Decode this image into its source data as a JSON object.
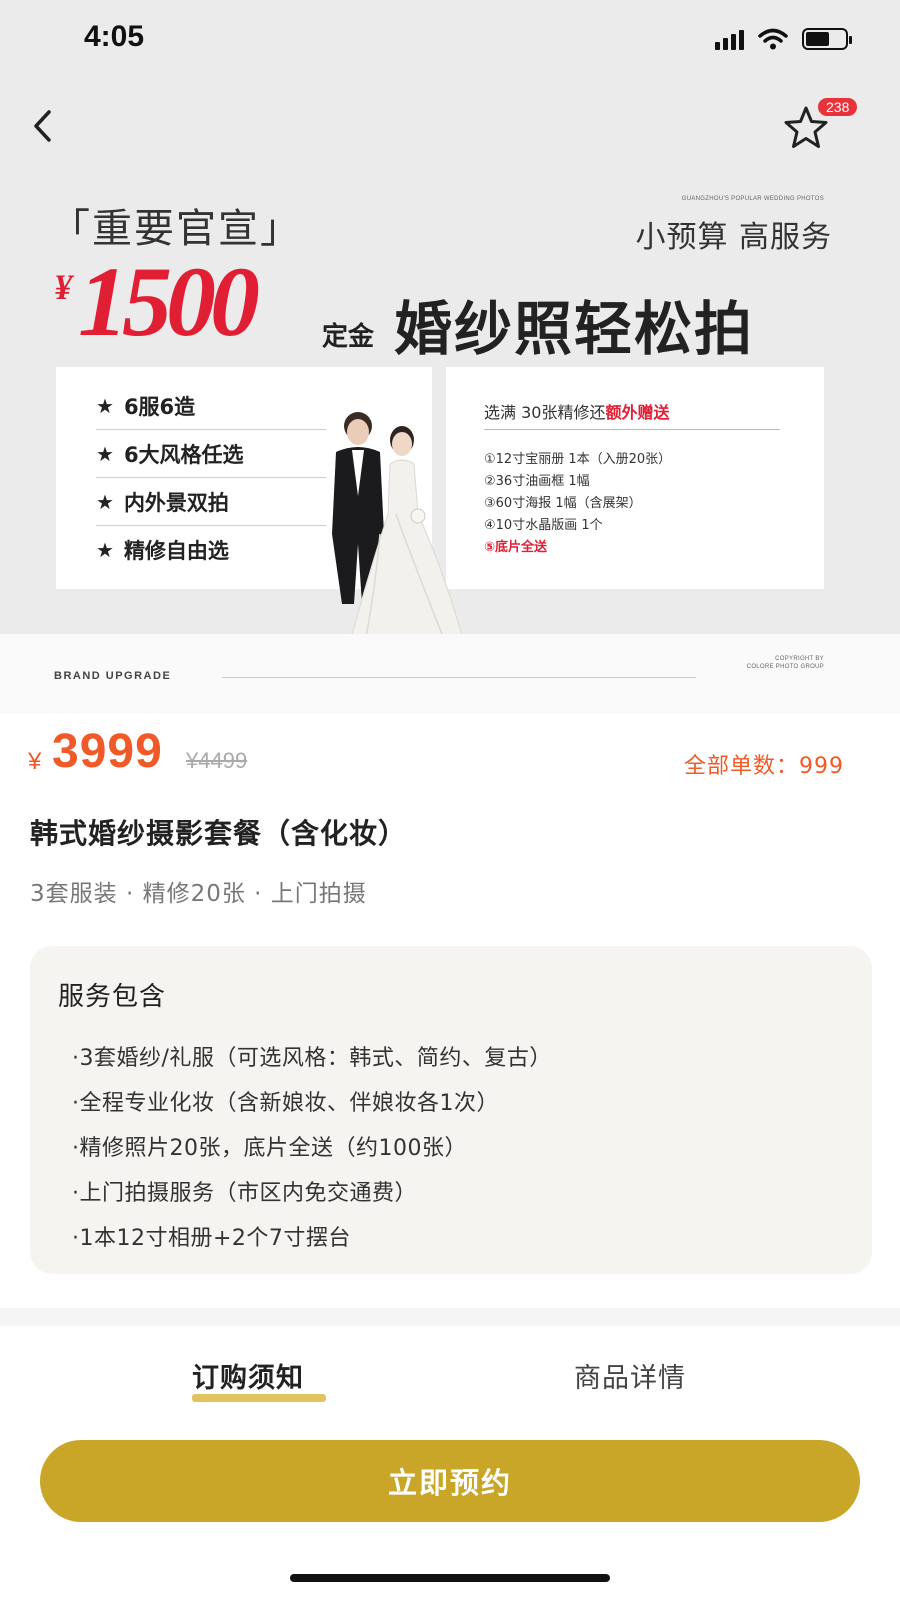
{
  "status_bar": {
    "time": "4:05"
  },
  "header": {
    "favorite_count": "238"
  },
  "banner": {
    "announce_title": "「重要官宣」",
    "tiny_caption_top": "GUANGZHOU'S POPULAR WEDDING PHOTOS",
    "subtitle": "小预算 高服务",
    "promo_currency": "¥",
    "promo_price": "1500",
    "deposit_label": "定金",
    "tagline": "婚纱照轻松拍",
    "features": [
      "6服6造",
      "6大风格任选",
      "内外景双拍",
      "精修自由选"
    ],
    "bonus_heading": "选满 30张精修还",
    "bonus_heading_highlight": "额外赠送",
    "bonus_items": [
      "①12寸宝丽册 1本（入册20张）",
      "②36寸油画框 1幅",
      "③60寸海报 1幅（含展架）",
      "④10寸水晶版画 1个",
      "⑤底片全送"
    ]
  },
  "brand": {
    "label": "BRAND   UPGRADE",
    "copyright_line1": "COPYRIGHT BY",
    "copyright_line2": "COLORE PHOTO GROUP"
  },
  "product": {
    "currency": "¥",
    "price": "3999",
    "original_price": "¥4499",
    "sold_label": "全部单数：",
    "sold_count": "999",
    "title": "韩式婚纱摄影套餐（含化妆）",
    "tags": "3套服装 · 精修20张 · 上门拍摄"
  },
  "service": {
    "title": "服务包含",
    "items": [
      "·3套婚纱/礼服（可选风格：韩式、简约、复古）",
      "·全程专业化妆（含新娘妆、伴娘妆各1次）",
      "·精修照片20张，底片全送（约100张）",
      "·上门拍摄服务（市区内免交通费）",
      "·1本12寸相册+2个7寸摆台"
    ]
  },
  "tabs": {
    "notice": "订购须知",
    "detail": "商品详情"
  },
  "actions": {
    "book_label": "立即预约"
  },
  "colors": {
    "accent_gold": "#c9a528",
    "price_orange": "#f05a28",
    "promo_red": "#e01f35"
  }
}
